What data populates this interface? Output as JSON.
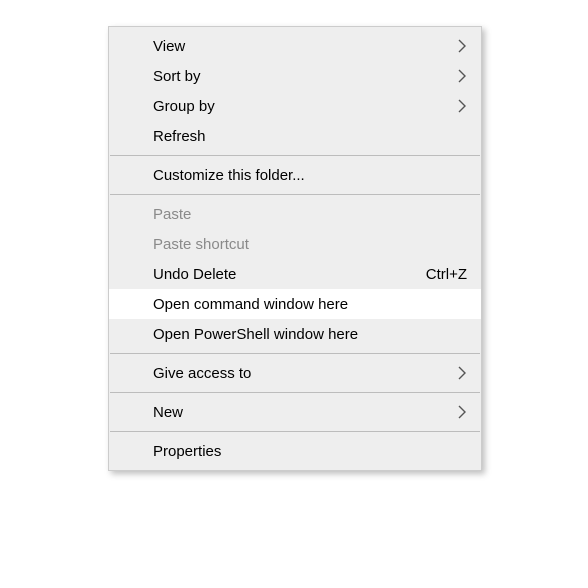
{
  "menu": {
    "items": [
      {
        "kind": "item",
        "name": "menu-item-view",
        "label": "View",
        "submenu": true
      },
      {
        "kind": "item",
        "name": "menu-item-sort-by",
        "label": "Sort by",
        "submenu": true
      },
      {
        "kind": "item",
        "name": "menu-item-group-by",
        "label": "Group by",
        "submenu": true
      },
      {
        "kind": "item",
        "name": "menu-item-refresh",
        "label": "Refresh"
      },
      {
        "kind": "separator"
      },
      {
        "kind": "item",
        "name": "menu-item-customize-folder",
        "label": "Customize this folder..."
      },
      {
        "kind": "separator"
      },
      {
        "kind": "item",
        "name": "menu-item-paste",
        "label": "Paste",
        "disabled": true
      },
      {
        "kind": "item",
        "name": "menu-item-paste-shortcut",
        "label": "Paste shortcut",
        "disabled": true
      },
      {
        "kind": "item",
        "name": "menu-item-undo-delete",
        "label": "Undo Delete",
        "shortcut": "Ctrl+Z"
      },
      {
        "kind": "item",
        "name": "menu-item-open-cmd-here",
        "label": "Open command window here",
        "highlight": true
      },
      {
        "kind": "item",
        "name": "menu-item-open-ps-here",
        "label": "Open PowerShell window here"
      },
      {
        "kind": "separator"
      },
      {
        "kind": "item",
        "name": "menu-item-give-access-to",
        "label": "Give access to",
        "submenu": true
      },
      {
        "kind": "separator"
      },
      {
        "kind": "item",
        "name": "menu-item-new",
        "label": "New",
        "submenu": true
      },
      {
        "kind": "separator"
      },
      {
        "kind": "item",
        "name": "menu-item-properties",
        "label": "Properties"
      }
    ]
  }
}
